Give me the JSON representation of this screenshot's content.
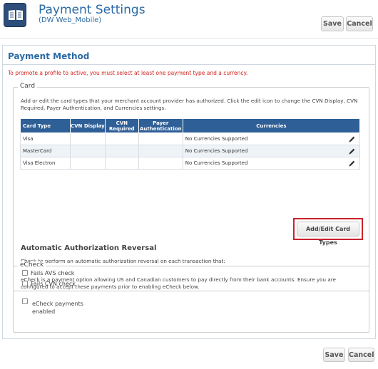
{
  "header": {
    "title": "Payment Settings",
    "subtitle": "(DW Web_Mobile)",
    "app_icon": "settings-book-icon",
    "save_label": "Save",
    "cancel_label": "Cancel"
  },
  "payment_method": {
    "title": "Payment Method",
    "warning": "To promote a profile to active, you must select at least one payment type and a currency.",
    "card": {
      "legend": "Card",
      "description": "Add or edit the card types that your merchant account provider has authorized. Click the edit icon to change the CVN Display, CVN Required, Payer Authentication, and Currencies settings.",
      "columns": [
        "Card Type",
        "CVN Display",
        "CVN Required",
        "Payer Authentication",
        "Currencies"
      ],
      "rows": [
        {
          "card_type": "Visa",
          "cvn_display": "",
          "cvn_required": "",
          "payer_auth": "",
          "currencies": "No Currencies Supported"
        },
        {
          "card_type": "MasterCard",
          "cvn_display": "",
          "cvn_required": "",
          "payer_auth": "",
          "currencies": "No Currencies Supported"
        },
        {
          "card_type": "Visa Electron",
          "cvn_display": "",
          "cvn_required": "",
          "payer_auth": "",
          "currencies": "No Currencies Supported"
        }
      ],
      "add_edit_label": "Add/Edit Card Types",
      "reversal": {
        "title": "Automatic Authorization Reversal",
        "description": "Check to perform an automatic authorization reversal on each transaction that:",
        "avs_label": "Fails AVS check",
        "cvn_label": "Fails CVN check"
      }
    },
    "echeck": {
      "legend": "eCheck",
      "description": "eCheck is a payment option allowing US and Canadian customers to pay directly from their bank accounts. Ensure you are configured to accept these payments prior to enabling eCheck below.",
      "enable_label": "eCheck payments enabled"
    }
  },
  "footer": {
    "save_label": "Save",
    "cancel_label": "Cancel"
  },
  "colors": {
    "title_blue": "#2b6aa5",
    "table_header": "#2f5f97",
    "warning_red": "#d0221c",
    "highlight_red": "#c9232b"
  }
}
